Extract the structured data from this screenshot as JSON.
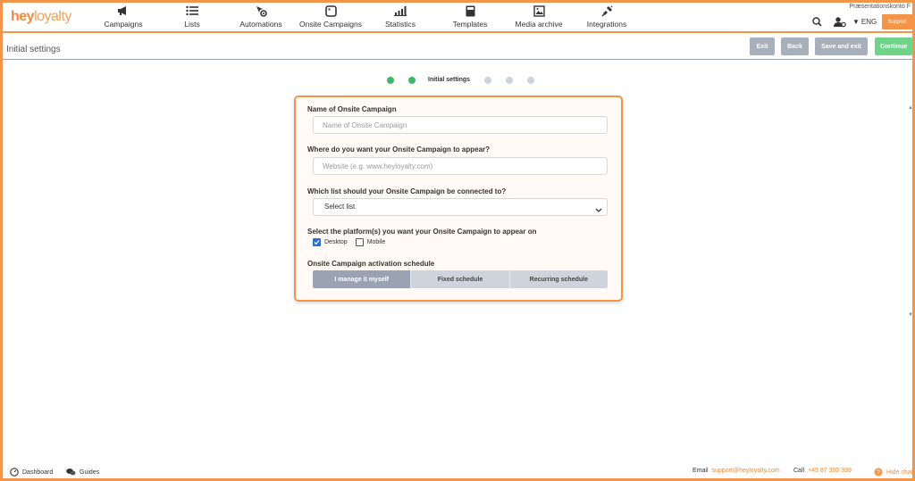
{
  "brand": {
    "logo_a": "hey",
    "logo_b": "loyalty",
    "accent": "#f39448"
  },
  "account": {
    "name": "Præsentationskonto F"
  },
  "nav": {
    "items": [
      {
        "label": "Campaigns",
        "icon": "megaphone-icon"
      },
      {
        "label": "Lists",
        "icon": "list-icon"
      },
      {
        "label": "Automations",
        "icon": "automation-icon"
      },
      {
        "label": "Onsite Campaigns",
        "icon": "onsite-icon"
      },
      {
        "label": "Statistics",
        "icon": "statistics-icon"
      },
      {
        "label": "Templates",
        "icon": "templates-icon"
      },
      {
        "label": "Media archive",
        "icon": "image-icon"
      },
      {
        "label": "Integrations",
        "icon": "plug-icon"
      }
    ],
    "language": "ENG",
    "support_label": "Support"
  },
  "header": {
    "title": "Initial settings",
    "buttons": {
      "exit": "Exit",
      "back": "Back",
      "save_exit": "Save and exit",
      "continue": "Continue"
    }
  },
  "steps": {
    "current_label": "Initial settings",
    "total": 6,
    "current_index": 3
  },
  "form": {
    "name": {
      "label": "Name of Onsite Campaign",
      "placeholder": "Name of Onsite Campaign",
      "value": ""
    },
    "website": {
      "label": "Where do you want your Onsite Campaign to appear?",
      "placeholder": "Website (e.g. www.heyloyalty.com)",
      "value": ""
    },
    "list": {
      "label": "Which list should your Onsite Campaign be connected to?",
      "selected": "Select list"
    },
    "platforms": {
      "label": "Select the platform(s) you want your Onsite Campaign to appear on",
      "options": [
        {
          "label": "Desktop",
          "checked": true
        },
        {
          "label": "Mobile",
          "checked": false
        }
      ]
    },
    "schedule": {
      "label": "Onsite Campaign activation schedule",
      "options": [
        "I manage it myself",
        "Fixed schedule",
        "Recurring schedule"
      ],
      "selected": "I manage it myself"
    }
  },
  "footer": {
    "dashboard": "Dashboard",
    "guides": "Guides",
    "email_label": "Email",
    "email": "support@heyloyalty.com",
    "call_label": "Call",
    "phone": "+45 87 300 399",
    "hide_chat": "Hide chat"
  }
}
